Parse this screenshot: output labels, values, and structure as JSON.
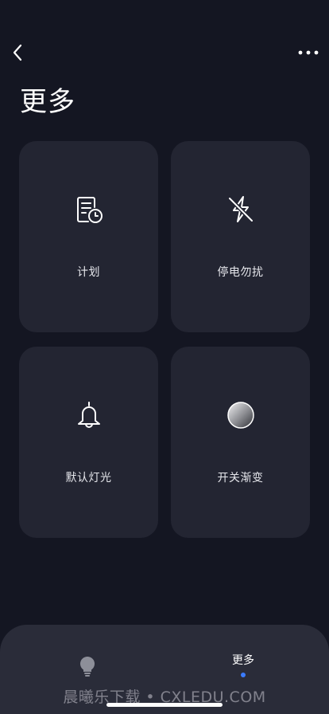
{
  "header": {
    "title": "更多"
  },
  "cards": [
    {
      "label": "计划",
      "icon": "schedule-icon"
    },
    {
      "label": "停电勿扰",
      "icon": "power-off-icon"
    },
    {
      "label": "默认灯光",
      "icon": "bell-icon"
    },
    {
      "label": "开关渐变",
      "icon": "gradient-circle-icon"
    }
  ],
  "bottom_nav": {
    "home_icon": "bulb-icon",
    "more_label": "更多",
    "active_color": "#3b7cff"
  },
  "watermark": "晨曦乐下载 • CXLEDU.COM",
  "colors": {
    "background": "#141622",
    "card": "#232532",
    "nav": "#2a2c39"
  }
}
